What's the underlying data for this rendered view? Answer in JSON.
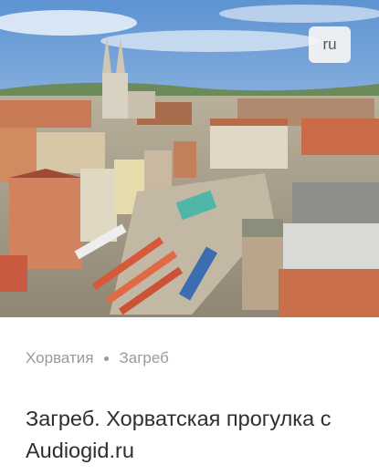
{
  "card": {
    "language_badge": "ru",
    "breadcrumb": {
      "country": "Хорватия",
      "city": "Загреб"
    },
    "title": "Загреб. Хорватская прогулка с Audiogid.ru"
  },
  "colors": {
    "badge_background": "#f5f5f5",
    "breadcrumb_text": "#9a9a9a",
    "title_text": "#2e2e2e"
  }
}
